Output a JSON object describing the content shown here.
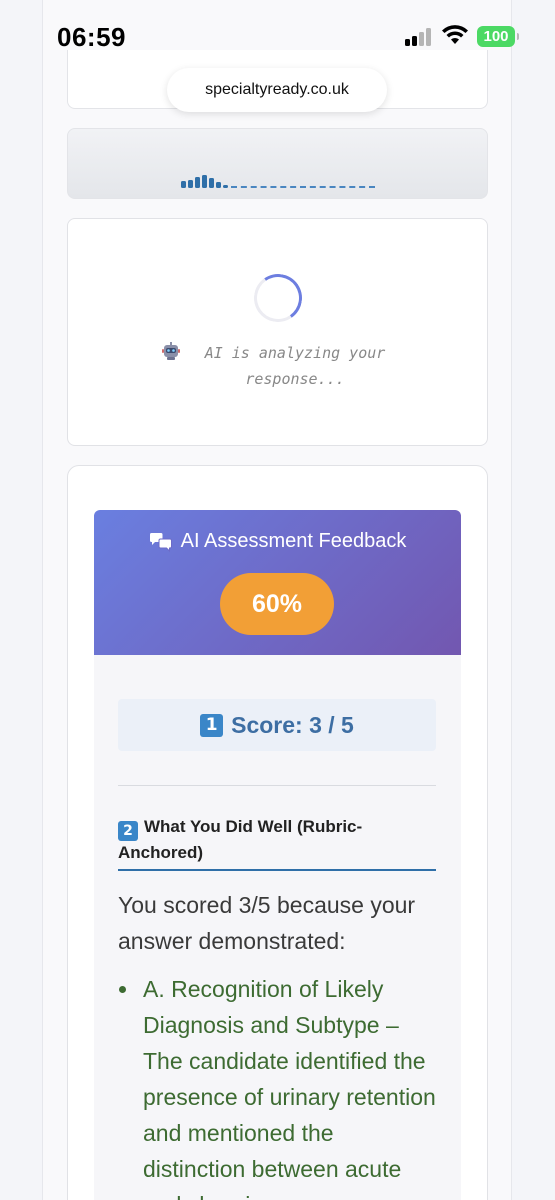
{
  "status_bar": {
    "time": "06:59",
    "battery": "100",
    "icons": [
      "signal-icon",
      "wifi-icon",
      "battery-icon"
    ]
  },
  "browser": {
    "url": "specialtyready.co.uk"
  },
  "loading": {
    "icon": "robot-icon",
    "message": "AI is analyzing your response..."
  },
  "feedback": {
    "icon": "speech-bubbles-icon",
    "title": "AI Assessment Feedback",
    "percent": "60%",
    "score_badge": "1",
    "score_text": "Score: 3 / 5",
    "section_badge": "2",
    "section_title": "What You Did Well (Rubric-Anchored)",
    "intro": "You scored 3/5 because your answer demonstrated:",
    "items": [
      "A. Recognition of Likely Diagnosis and Subtype – The candidate identified the presence of urinary retention and mentioned the distinction between acute and chronic..."
    ]
  },
  "colors": {
    "header_gradient_start": "#6a7fe0",
    "header_gradient_end": "#7257b0",
    "percent_pill": "#f29f36",
    "score_text": "#3d6ea3",
    "bullet_text": "#3d6b32",
    "battery": "#4cd964"
  }
}
